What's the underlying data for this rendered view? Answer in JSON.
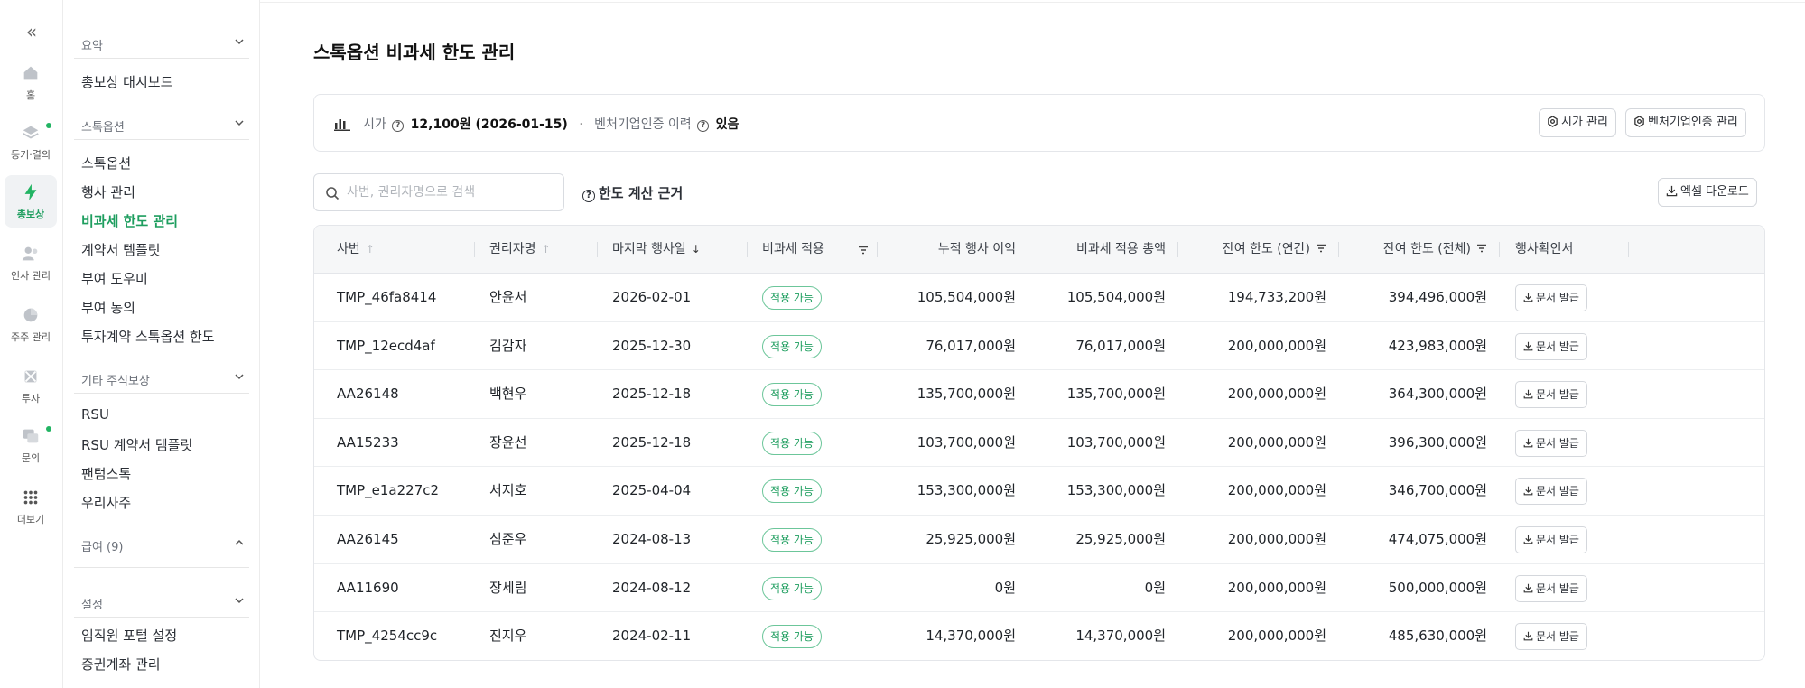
{
  "rail": {
    "collapse_glyph": "«",
    "items": [
      {
        "label": "홈",
        "icon": "home-icon"
      },
      {
        "label": "등기·결의",
        "icon": "layers-icon",
        "dot": true
      },
      {
        "label": "총보상",
        "icon": "bolt-icon",
        "active": true
      },
      {
        "label": "인사 관리",
        "icon": "people-icon"
      },
      {
        "label": "주주 관리",
        "icon": "pie-icon"
      },
      {
        "label": "투자",
        "icon": "invest-icon"
      },
      {
        "label": "문의",
        "icon": "chat-icon",
        "dot": true
      },
      {
        "label": "더보기",
        "icon": "grid-icon"
      }
    ]
  },
  "sidenav": {
    "sections": [
      {
        "title": "요약",
        "items": [
          "총보상 대시보드"
        ]
      },
      {
        "title": "스톡옵션",
        "items": [
          "스톡옵션",
          "행사 관리",
          "비과세 한도 관리",
          "계약서 템플릿",
          "부여 도우미",
          "부여 동의",
          "투자계약 스톡옵션 한도"
        ]
      },
      {
        "title": "기타 주식보상",
        "items": [
          "RSU",
          "RSU 계약서 템플릿",
          "팬텀스톡",
          "우리사주"
        ]
      },
      {
        "title": "급여 (9)",
        "items": []
      },
      {
        "title": "설정",
        "items": [
          "임직원 포털 설정",
          "증권계좌 관리"
        ]
      }
    ],
    "active_item": "비과세 한도 관리"
  },
  "page_title": "스톡옵션 비과세 한도 관리",
  "info": {
    "fair_value_label": "시가",
    "fair_value": "12,100원 (2026-01-15)",
    "separator": "·",
    "venture_label": "벤처기업인증 이력",
    "venture_value": "있음",
    "fair_value_btn": "시가 관리",
    "venture_btn": "벤처기업인증 관리"
  },
  "toolbar": {
    "search_placeholder": "사번, 권리자명으로 검색",
    "calc_link": "한도 계산 근거",
    "excel_btn": "엑셀 다운로드"
  },
  "table": {
    "headers": [
      "사번",
      "권리자명",
      "마지막 행사일",
      "비과세 적용",
      "누적 행사 이익",
      "비과세 적용 총액",
      "잔여 한도 (연간)",
      "잔여 한도 (전체)",
      "행사확인서"
    ],
    "badge_label": "적용 가능",
    "doc_label": "문서 발급",
    "rows": [
      {
        "id": "TMP_46fa8414",
        "name": "안윤서",
        "date": "2026-02-01",
        "cum": "105,504,000원",
        "total": "105,504,000원",
        "annual": "194,733,200원",
        "overall": "394,496,000원"
      },
      {
        "id": "TMP_12ecd4af",
        "name": "김감자",
        "date": "2025-12-30",
        "cum": "76,017,000원",
        "total": "76,017,000원",
        "annual": "200,000,000원",
        "overall": "423,983,000원"
      },
      {
        "id": "AA26148",
        "name": "백현우",
        "date": "2025-12-18",
        "cum": "135,700,000원",
        "total": "135,700,000원",
        "annual": "200,000,000원",
        "overall": "364,300,000원"
      },
      {
        "id": "AA15233",
        "name": "장윤선",
        "date": "2025-12-18",
        "cum": "103,700,000원",
        "total": "103,700,000원",
        "annual": "200,000,000원",
        "overall": "396,300,000원"
      },
      {
        "id": "TMP_e1a227c2",
        "name": "서지호",
        "date": "2025-04-04",
        "cum": "153,300,000원",
        "total": "153,300,000원",
        "annual": "200,000,000원",
        "overall": "346,700,000원"
      },
      {
        "id": "AA26145",
        "name": "심준우",
        "date": "2024-08-13",
        "cum": "25,925,000원",
        "total": "25,925,000원",
        "annual": "200,000,000원",
        "overall": "474,075,000원"
      },
      {
        "id": "AA11690",
        "name": "장세림",
        "date": "2024-08-12",
        "cum": "0원",
        "total": "0원",
        "annual": "200,000,000원",
        "overall": "500,000,000원"
      },
      {
        "id": "TMP_4254cc9c",
        "name": "진지우",
        "date": "2024-02-11",
        "cum": "14,370,000원",
        "total": "14,370,000원",
        "annual": "200,000,000원",
        "overall": "485,630,000원"
      }
    ]
  },
  "colors": {
    "accent": "#1e9e5f",
    "badge_border": "#6cc69a"
  }
}
